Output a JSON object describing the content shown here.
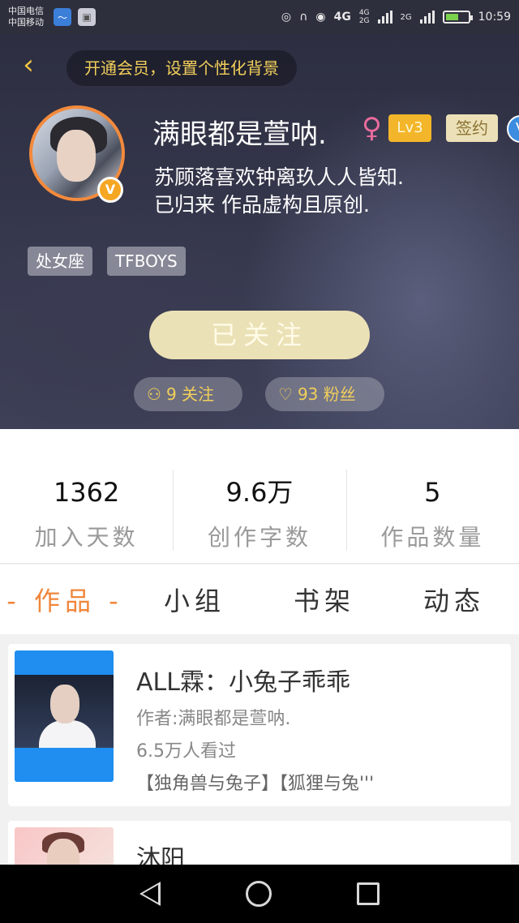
{
  "status_bar": {
    "carrier_1": "中国电信",
    "carrier_2": "中国移动",
    "net_4g": "4G",
    "net_4g_small": "4G",
    "net_2g_small": "2G",
    "net_2g": "2G",
    "time": "10:59",
    "battery_level": 0.6
  },
  "header": {
    "vip_banner": "开通会员，设置个性化背景",
    "username": "满眼都是萱呐.",
    "gender_symbol": "♀",
    "level_badge": "Lv3",
    "sign_badge": "签约",
    "verify_badge": "V",
    "avatar_badge": "V",
    "bio_line_1": "苏顾落喜欢钟离玖人人皆知.",
    "bio_line_2": "已归来 作品虚构且原创.",
    "tags": [
      "处女座",
      "TFBOYS"
    ],
    "follow_button": "已关注",
    "following": "9 关注",
    "fans": "93 粉丝"
  },
  "stats": [
    {
      "value": "1362",
      "label": "加入天数"
    },
    {
      "value": "9.6万",
      "label": "创作字数"
    },
    {
      "value": "5",
      "label": "作品数量"
    }
  ],
  "tabs": [
    "- 作品 -",
    "小组",
    "书架",
    "动态"
  ],
  "works": [
    {
      "title": "ALL霖：小兔子乖乖",
      "author": "作者:满眼都是萱呐.",
      "views": "6.5万人看过",
      "tags": "【独角兽与兔子】【狐狸与兔'''"
    },
    {
      "title": "沐阳"
    }
  ],
  "icons": {
    "back": "chevron-left-icon",
    "gender": "female-icon",
    "following": "person-add-icon",
    "fans": "heart-icon"
  },
  "colors": {
    "accent": "#f0863c",
    "gold": "#f2cf5b",
    "follow_button": "#ebe1b6"
  }
}
